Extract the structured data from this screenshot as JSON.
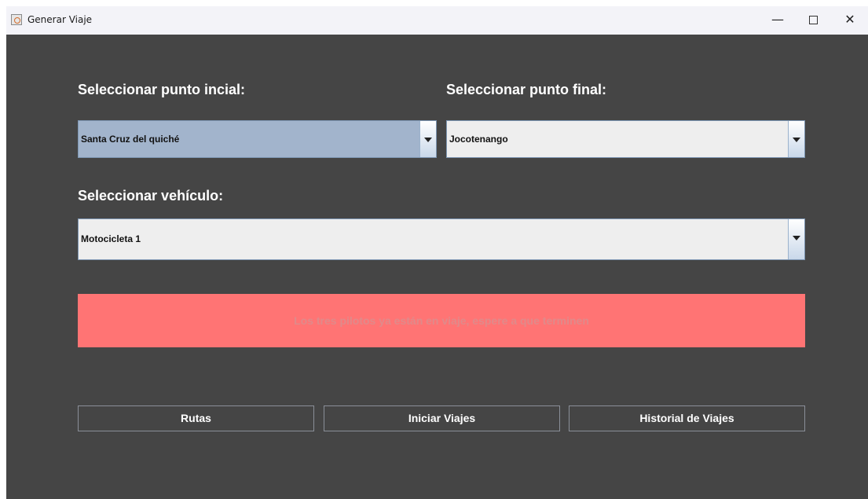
{
  "window": {
    "title": "Generar Viaje",
    "min_glyph": "—",
    "close_glyph": "✕"
  },
  "form": {
    "origin_label": "Seleccionar punto incial:",
    "origin_value": "Santa Cruz del quiché",
    "destination_label": "Seleccionar punto final:",
    "destination_value": "Jocotenango",
    "vehicle_label": "Seleccionar vehículo:",
    "vehicle_value": "Motocicleta 1"
  },
  "warning": {
    "text": "Los tres pilotos ya están en viaje, espere a que terminen",
    "bg_color": "#ff7474"
  },
  "buttons": {
    "routes": "Rutas",
    "start_trips": "Iniciar Viajes",
    "trip_history": "Historial de Viajes"
  },
  "colors": {
    "background": "#454545",
    "selected_combo": "#a2b4cc",
    "combo": "#eeeeee"
  }
}
